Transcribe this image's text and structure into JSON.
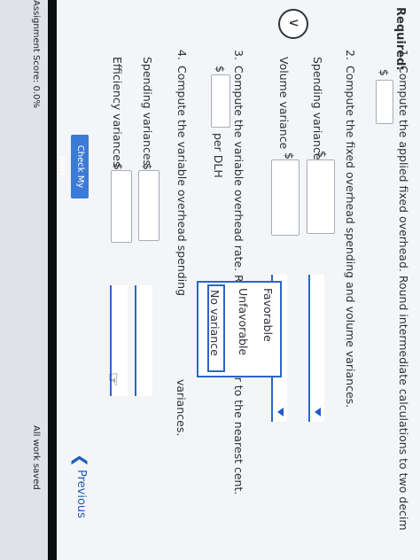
{
  "required_heading": "Required:",
  "q1": {
    "number": "1.",
    "text": "Compute the applied fixed overhead. Round intermediate calculations to two decim",
    "currency": "$",
    "value": ""
  },
  "q2": {
    "number": "2.",
    "text": "Compute the fixed overhead spending and volume variances.",
    "rows": [
      {
        "label": "Spending variance",
        "currency": "$",
        "value": "",
        "select_value": ""
      },
      {
        "label": "Volume variance",
        "currency": "$",
        "value": "",
        "select_value": ""
      }
    ]
  },
  "q3": {
    "number": "3.",
    "text": "Compute the variable overhead rate. Round your answer to the nearest cent.",
    "currency": "$",
    "value": "",
    "unit": "per DLH"
  },
  "q4": {
    "number": "4.",
    "text_before": "Compute the variable overhead spending",
    "text_after": "variances.",
    "rows": [
      {
        "label": "Spending variances",
        "currency": "$",
        "value": ""
      },
      {
        "label": "Efficiency variances",
        "currency": "$",
        "value": ""
      }
    ]
  },
  "dropdown": {
    "options": [
      "Favorable",
      "Unfavorable",
      "No variance"
    ],
    "selected_index": 2
  },
  "footer": {
    "check_button": "Check My Work",
    "previous_link": "Previous",
    "score_text": "Assignment Score: 0.0%",
    "bottom_text": "All work saved"
  },
  "icons": {
    "expand": "chevron-down-icon",
    "cursor": "hand-cursor-icon",
    "previous": "chevron-left-icon"
  },
  "colors": {
    "accent": "#2a67c9",
    "link": "#1e5db8",
    "button": "#3b7bd8"
  }
}
